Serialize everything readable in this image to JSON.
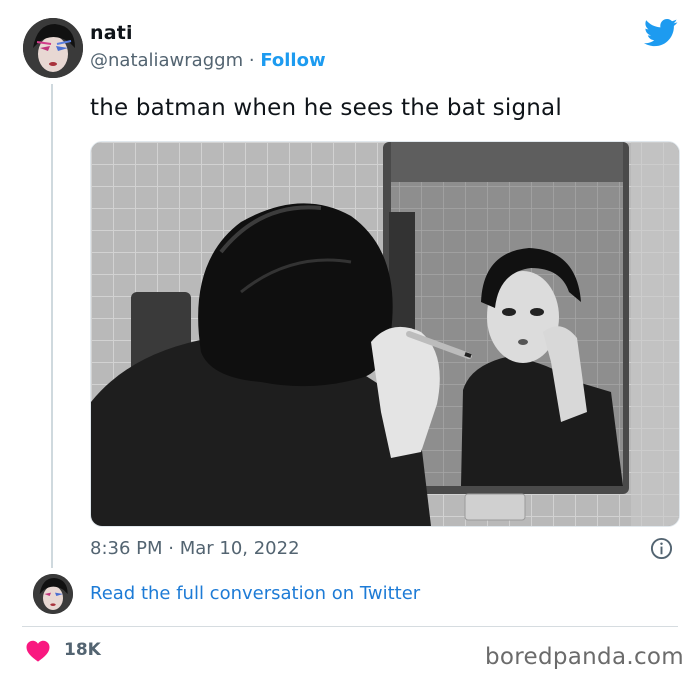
{
  "author": {
    "display_name": "nati",
    "handle": "@nataliawraggm",
    "separator": "·",
    "follow_label": "Follow"
  },
  "tweet": {
    "text": "the batman when he sees the bat signal",
    "timestamp": "8:36 PM · Mar 10, 2022"
  },
  "conversation": {
    "link_label": "Read the full conversation on Twitter"
  },
  "engagement": {
    "likes": "18K"
  },
  "watermark": "boredpanda.com",
  "colors": {
    "accent": "#1d9bf0",
    "heart": "#f91880",
    "muted_text": "#536471"
  },
  "icons": {
    "brand": "twitter-bird-icon",
    "info": "info-icon",
    "like": "heart-icon"
  }
}
